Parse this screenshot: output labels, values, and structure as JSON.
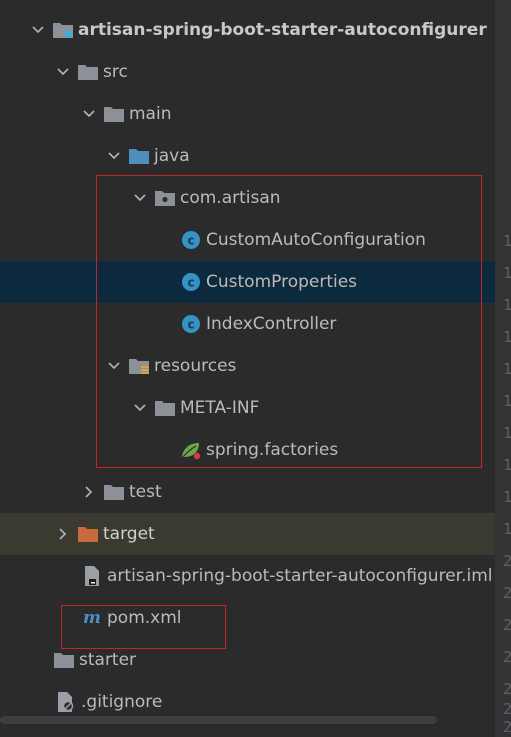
{
  "tree": {
    "root_label": "artisan-spring-boot-starter-autoconfigurer",
    "src_label": "src",
    "main_label": "main",
    "java_label": "java",
    "package_label": "com.artisan",
    "class1_label": "CustomAutoConfiguration",
    "class2_label": "CustomProperties",
    "class3_label": "IndexController",
    "resources_label": "resources",
    "metainf_label": "META-INF",
    "factories_label": "spring.factories",
    "test_label": "test",
    "target_label": "target",
    "iml_label": "artisan-spring-boot-starter-autoconfigurer.iml",
    "pom_label": "pom.xml",
    "starter_label": "starter",
    "gitignore_label": ".gitignore"
  },
  "gutter_digits": [
    "1",
    "1",
    "1",
    "1",
    "1",
    "1",
    "1",
    "1",
    "1",
    "1",
    "2",
    "2",
    "2",
    "2",
    "2",
    "2",
    "2"
  ],
  "icons": {
    "folder": "folder-icon",
    "module": "module-folder-icon",
    "source_root": "source-root-folder-icon",
    "package": "package-icon",
    "class": "class-icon",
    "resources": "resources-folder-icon",
    "spring_config": "spring-factories-icon",
    "excluded": "excluded-folder-icon",
    "iml": "iml-file-icon",
    "maven": "maven-pom-icon",
    "gitignore": "gitignore-file-icon"
  },
  "colors": {
    "background": "#2b2b2b",
    "selection": "#0d293e",
    "excluded_row": "#3a3a30",
    "folder": "#8b9196",
    "source_folder": "#4e8fbd",
    "class_icon": "#3592c4",
    "excluded_folder": "#c86b3a",
    "highlight_box": "#c0272d"
  }
}
